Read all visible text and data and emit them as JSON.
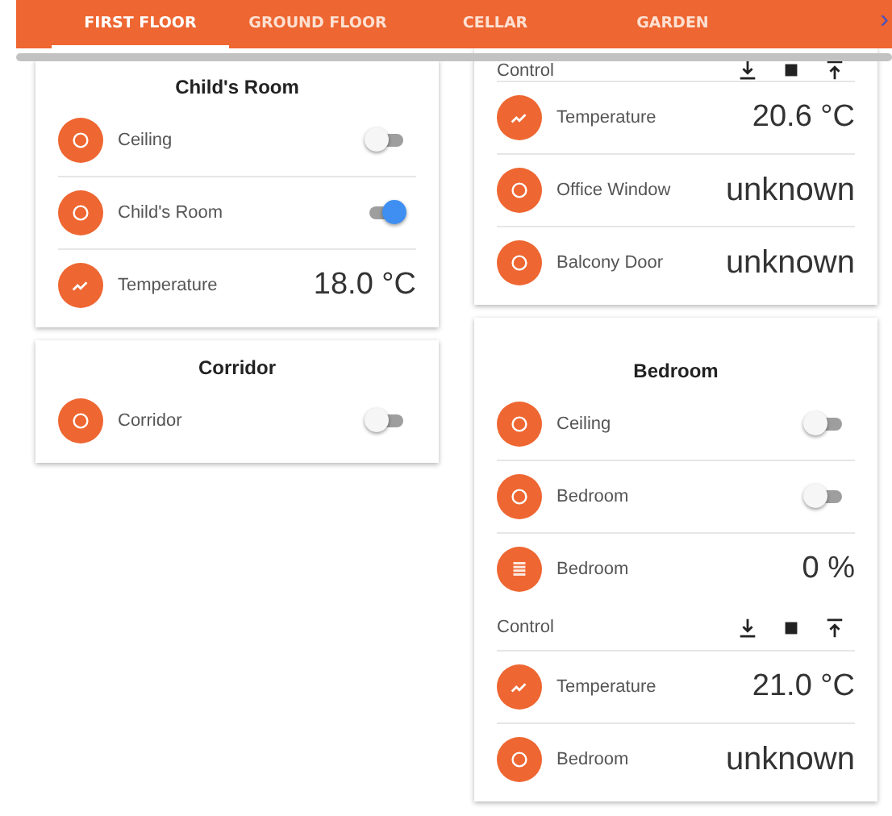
{
  "tabs": [
    {
      "label": "FIRST FLOOR",
      "selected": true
    },
    {
      "label": "GROUND FLOOR",
      "selected": false
    },
    {
      "label": "CELLAR",
      "selected": false
    },
    {
      "label": "GARDEN",
      "selected": false
    }
  ],
  "tab_scroll_arrow": "›",
  "columns": [
    {
      "cards": [
        {
          "title": "Child's Room",
          "rows": [
            {
              "kind": "switch",
              "label": "Ceiling",
              "on": false
            },
            {
              "kind": "switch",
              "label": "Child's Room",
              "on": true
            },
            {
              "kind": "temperature",
              "label": "Temperature",
              "value": "18.0 °C"
            }
          ]
        },
        {
          "title": "Corridor",
          "rows": [
            {
              "kind": "switch",
              "label": "Corridor",
              "on": false
            }
          ]
        }
      ]
    },
    {
      "cards": [
        {
          "rows": [
            {
              "kind": "control",
              "label": "Control"
            },
            {
              "kind": "temperature",
              "label": "Temperature",
              "value": "20.6 °C"
            },
            {
              "kind": "state",
              "label": "Office Window",
              "value": "unknown"
            },
            {
              "kind": "state",
              "label": "Balcony Door",
              "value": "unknown"
            }
          ]
        },
        {
          "title": "Bedroom",
          "rows": [
            {
              "kind": "switch",
              "label": "Ceiling",
              "on": false
            },
            {
              "kind": "switch",
              "label": "Bedroom",
              "on": false
            },
            {
              "kind": "cover",
              "label": "Bedroom",
              "value": "0 %"
            },
            {
              "kind": "control",
              "label": "Control"
            },
            {
              "kind": "temperature",
              "label": "Temperature",
              "value": "21.0 °C"
            },
            {
              "kind": "state",
              "label": "Bedroom",
              "value": "unknown"
            }
          ]
        }
      ]
    }
  ]
}
